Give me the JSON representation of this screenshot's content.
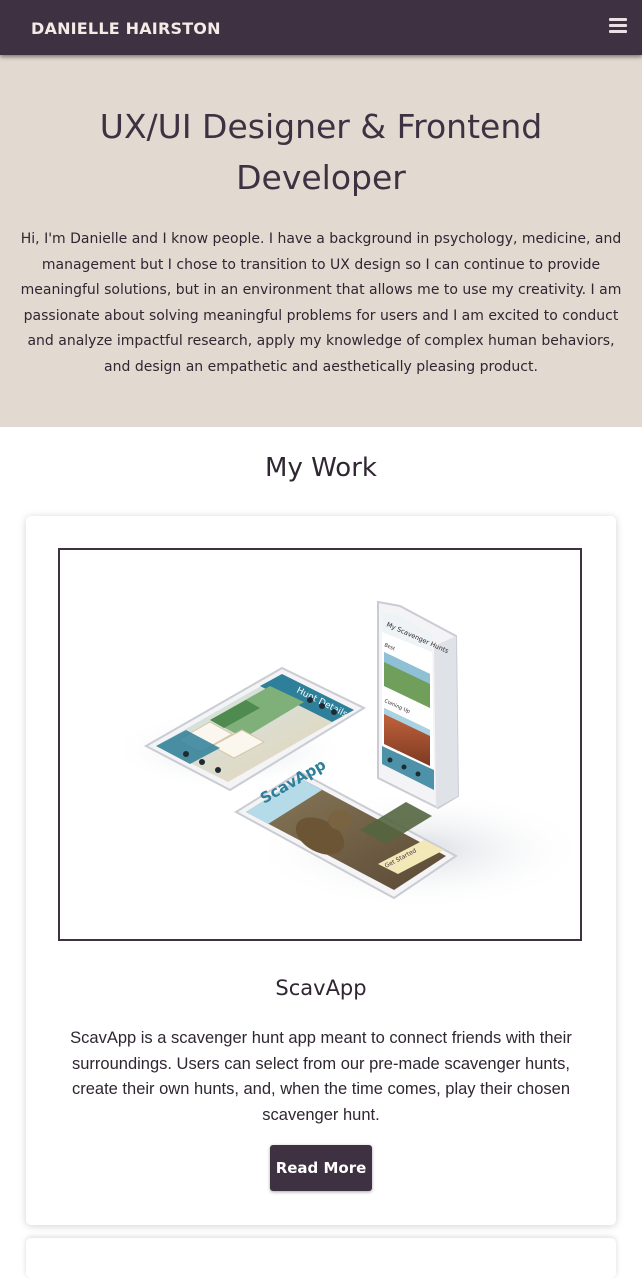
{
  "navbar": {
    "brand": "DANIELLE HAIRSTON",
    "menu_icon": "hamburger-menu-icon"
  },
  "hero": {
    "title": "UX/UI Designer & Frontend Developer",
    "intro": "Hi, I'm Danielle and I know people. I have a background in psychology, medicine, and management but I chose to transition to UX design so I can continue to provide meaningful solutions, but in an environment that allows me to use my creativity. I am passionate about solving meaningful problems for users and I am excited to conduct and analyze impactful research, apply my knowledge of complex human behaviors, and design an empathetic and aesthetically pleasing product."
  },
  "work": {
    "heading": "My Work",
    "projects": [
      {
        "title": "ScavApp",
        "description": "ScavApp is a scavenger hunt app meant to connect friends with their surroundings. Users can select from our pre-made scavenger hunts, create their own hunts, and, when the time comes, play their chosen scavenger hunt.",
        "button_label": "Read More",
        "mockup": {
          "screen_hunt_details": "Hunt Details",
          "screen_my_hunts": "My Scavenger Hunts",
          "screen_logo": "ScavApp",
          "screen_cta": "Get Started",
          "screen_section_1": "Best",
          "screen_section_2": "Coming Up"
        }
      }
    ]
  },
  "colors": {
    "navbar": "#3e3141",
    "hero_background": "#e2dad1",
    "text": "#2f2632",
    "button": "#3e3141",
    "phone_screen_accent": "#2e7f99"
  }
}
